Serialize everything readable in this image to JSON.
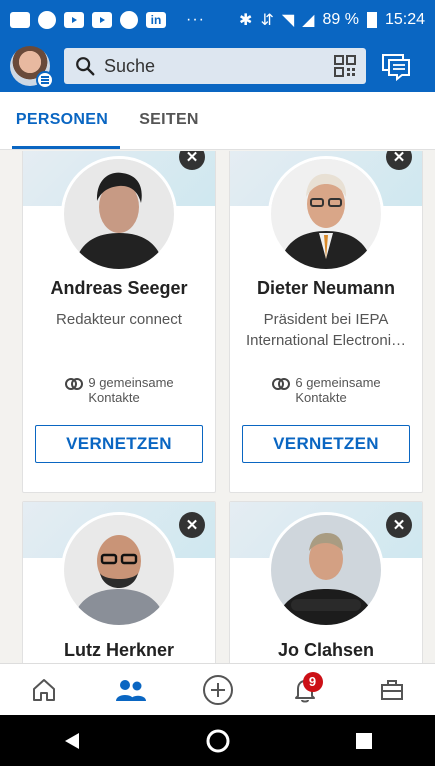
{
  "statusbar": {
    "dots": "···",
    "battery": "89 %",
    "time": "15:24"
  },
  "header": {
    "search_placeholder": "Suche"
  },
  "tabs": [
    {
      "label": "PERSONEN",
      "active": true
    },
    {
      "label": "SEITEN",
      "active": false
    }
  ],
  "cards": [
    {
      "name": "Andreas Seeger",
      "title": "Redakteur connect",
      "mutual_line1": "9 gemeinsame",
      "mutual_line2": "Kontakte",
      "connect": "VERNETZEN"
    },
    {
      "name": "Dieter Neumann",
      "title": "Präsident bei IEPA International Electroni…",
      "mutual_line1": "6 gemeinsame",
      "mutual_line2": "Kontakte",
      "connect": "VERNETZEN"
    },
    {
      "name": "Lutz Herkner"
    },
    {
      "name": "Jo Clahsen"
    }
  ],
  "bottomnav": {
    "notifications_count": "9"
  },
  "colors": {
    "brand": "#0a66c2",
    "badge": "#cc1016"
  }
}
